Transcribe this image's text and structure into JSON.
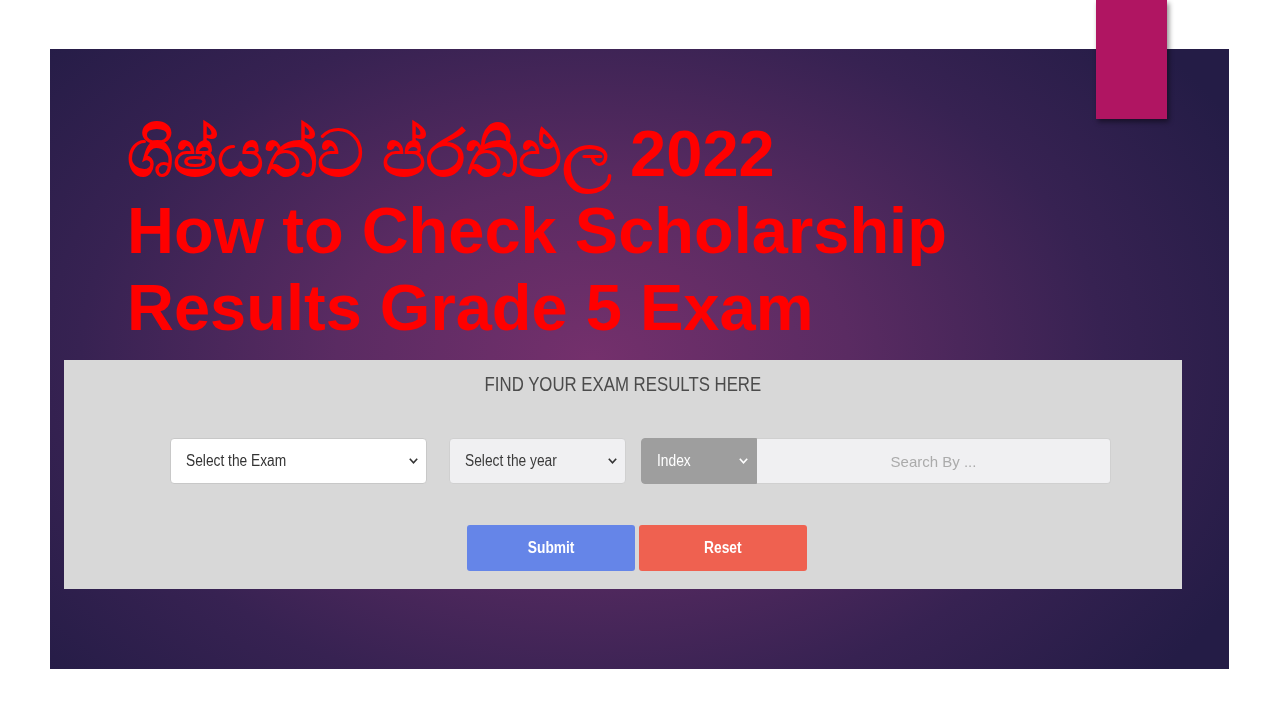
{
  "slide": {
    "title_lines": [
      "ශිෂ්යත්ව ප්රතිඵල 2022",
      "How to Check Scholarship",
      "Results Grade 5 Exam"
    ],
    "form": {
      "heading": "FIND YOUR EXAM RESULTS HERE",
      "exam_select": {
        "value": "Select the Exam"
      },
      "year_select": {
        "value": "Select the year"
      },
      "search_type_select": {
        "value": "Index"
      },
      "search_field": {
        "placeholder": "Search By ..."
      },
      "buttons": [
        {
          "label": "Submit",
          "kind": "submit"
        },
        {
          "label": "Reset",
          "kind": "reset"
        }
      ]
    }
  }
}
